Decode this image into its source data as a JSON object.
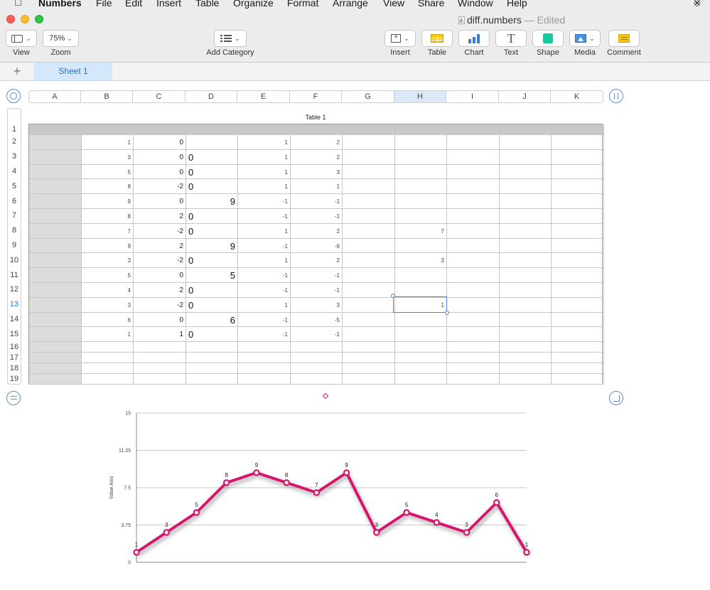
{
  "menubar": {
    "items": [
      {
        "label": "Numbers",
        "left": 54,
        "app": true
      },
      {
        "label": "File",
        "left": 135
      },
      {
        "label": "Edit",
        "left": 176
      },
      {
        "label": "Insert",
        "left": 220
      },
      {
        "label": "Table",
        "left": 275
      },
      {
        "label": "Organize",
        "left": 328
      },
      {
        "label": "Format",
        "left": 404
      },
      {
        "label": "Arrange",
        "left": 468
      },
      {
        "label": "View",
        "left": 539
      },
      {
        "label": "Share",
        "left": 588
      },
      {
        "label": "Window",
        "left": 644
      },
      {
        "label": "Help",
        "left": 713
      }
    ]
  },
  "window": {
    "title": "diff.numbers",
    "status": "— Edited"
  },
  "toolbar": {
    "view_label": "View",
    "zoom_value": "75%",
    "zoom_label": "Zoom",
    "add_category_label": "Add Category",
    "insert_label": "Insert",
    "table_label": "Table",
    "chart_label": "Chart",
    "text_label": "Text",
    "shape_label": "Shape",
    "media_label": "Media",
    "comment_label": "Comment"
  },
  "sheets": {
    "active": "Sheet 1",
    "add": "+"
  },
  "table": {
    "title": "Table 1",
    "columns": [
      "A",
      "B",
      "C",
      "D",
      "E",
      "F",
      "G",
      "H",
      "I",
      "J",
      "K"
    ],
    "selected_column": "H",
    "selected_row": 13,
    "row_numbers": [
      1,
      2,
      3,
      4,
      5,
      6,
      7,
      8,
      9,
      10,
      11,
      12,
      13,
      14,
      15,
      16,
      17,
      18,
      19
    ],
    "rows": [
      {
        "B": "1",
        "C": "0",
        "D": "",
        "E": "1",
        "F": "2",
        "H": ""
      },
      {
        "B": "3",
        "C": "0",
        "D": "0",
        "E": "1",
        "F": "2",
        "H": ""
      },
      {
        "B": "5",
        "C": "0",
        "D": "0",
        "E": "1",
        "F": "3",
        "H": ""
      },
      {
        "B": "8",
        "C": "-2",
        "D": "0",
        "E": "1",
        "F": "1",
        "H": ""
      },
      {
        "B": "9",
        "C": "0",
        "D": "9",
        "E": "-1",
        "F": "-1",
        "H": ""
      },
      {
        "B": "8",
        "C": "2",
        "D": "0",
        "E": "-1",
        "F": "-1",
        "H": ""
      },
      {
        "B": "7",
        "C": "-2",
        "D": "0",
        "E": "1",
        "F": "2",
        "H": "7"
      },
      {
        "B": "9",
        "C": "2",
        "D": "9",
        "E": "-1",
        "F": "-6",
        "H": ""
      },
      {
        "B": "3",
        "C": "-2",
        "D": "0",
        "E": "1",
        "F": "2",
        "H": "3"
      },
      {
        "B": "5",
        "C": "0",
        "D": "5",
        "E": "-1",
        "F": "-1",
        "H": ""
      },
      {
        "B": "4",
        "C": "2",
        "D": "0",
        "E": "-1",
        "F": "-1",
        "H": ""
      },
      {
        "B": "3",
        "C": "-2",
        "D": "0",
        "E": "1",
        "F": "3",
        "H": "1"
      },
      {
        "B": "6",
        "C": "0",
        "D": "6",
        "E": "-1",
        "F": "-5",
        "H": ""
      },
      {
        "B": "1",
        "C": "1",
        "D": "0",
        "E": "-1",
        "F": "-1",
        "H": ""
      }
    ]
  },
  "chart_data": {
    "type": "line",
    "ylabel": "Value Axis",
    "ylim": [
      0,
      15
    ],
    "yticks": [
      "0",
      "3.75",
      "7.5",
      "11.25",
      "15"
    ],
    "grid": true,
    "color": "#d6156c",
    "series": [
      {
        "values": [
          1,
          3,
          5,
          8,
          9,
          8,
          7,
          9,
          3,
          5,
          4,
          3,
          6,
          1
        ]
      }
    ]
  }
}
